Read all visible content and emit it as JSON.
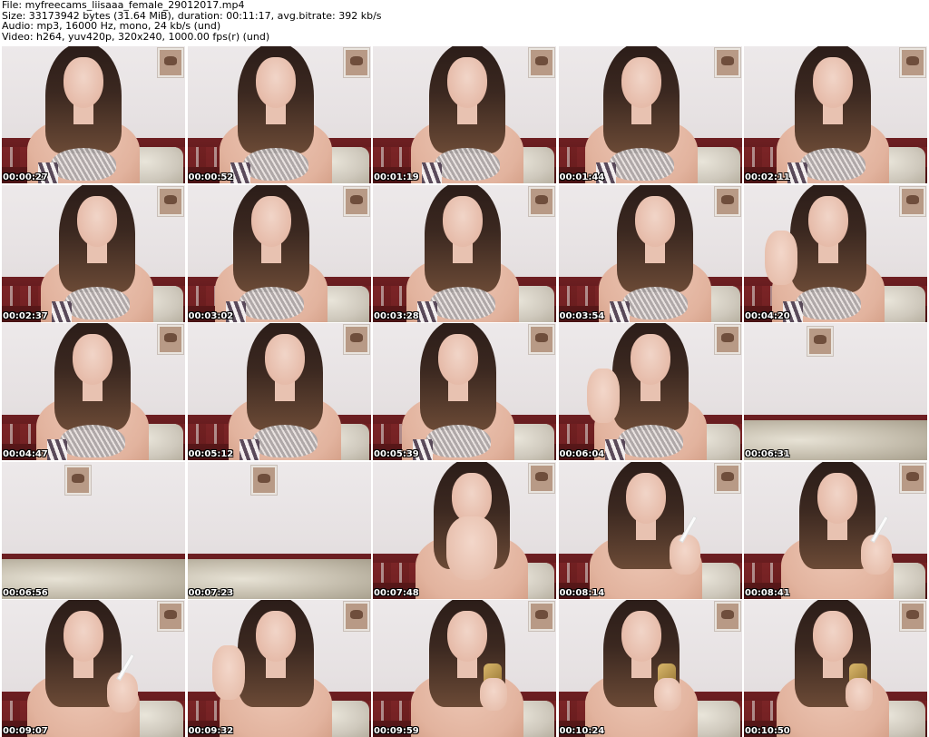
{
  "header": {
    "file_line": "File: myfreecams_liisaaa_female_29012017.mp4",
    "size_line": "Size: 33173942 bytes (31.64 MiB), duration: 00:11:17, avg.bitrate: 392 kb/s",
    "audio_line": "Audio: mp3, 16000 Hz, mono, 24 kb/s (und)",
    "video_line": "Video: h264, yuv420p, 320x240, 1000.00 fps(r) (und)"
  },
  "thumbnails": [
    {
      "timestamp": "00:00:27",
      "scene": "person"
    },
    {
      "timestamp": "00:00:52",
      "scene": "person"
    },
    {
      "timestamp": "00:01:19",
      "scene": "person"
    },
    {
      "timestamp": "00:01:44",
      "scene": "person"
    },
    {
      "timestamp": "00:02:11",
      "scene": "person"
    },
    {
      "timestamp": "00:02:37",
      "scene": "person"
    },
    {
      "timestamp": "00:03:02",
      "scene": "person"
    },
    {
      "timestamp": "00:03:28",
      "scene": "person"
    },
    {
      "timestamp": "00:03:54",
      "scene": "person"
    },
    {
      "timestamp": "00:04:20",
      "scene": "person-hand"
    },
    {
      "timestamp": "00:04:47",
      "scene": "person"
    },
    {
      "timestamp": "00:05:12",
      "scene": "person"
    },
    {
      "timestamp": "00:05:39",
      "scene": "person"
    },
    {
      "timestamp": "00:06:04",
      "scene": "person-hand"
    },
    {
      "timestamp": "00:06:31",
      "scene": "empty"
    },
    {
      "timestamp": "00:06:56",
      "scene": "empty"
    },
    {
      "timestamp": "00:07:23",
      "scene": "empty"
    },
    {
      "timestamp": "00:07:48",
      "scene": "person-hands"
    },
    {
      "timestamp": "00:08:14",
      "scene": "person-cigarette"
    },
    {
      "timestamp": "00:08:41",
      "scene": "person-cigarette"
    },
    {
      "timestamp": "00:09:07",
      "scene": "person-cigarette"
    },
    {
      "timestamp": "00:09:32",
      "scene": "person-hand"
    },
    {
      "timestamp": "00:09:59",
      "scene": "person-phone"
    },
    {
      "timestamp": "00:10:24",
      "scene": "person-phone"
    },
    {
      "timestamp": "00:10:50",
      "scene": "person-phone"
    }
  ]
}
